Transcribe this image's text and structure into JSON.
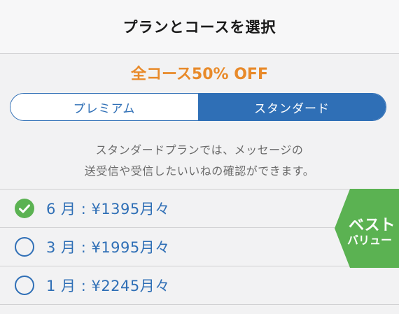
{
  "header": {
    "title": "プランとコースを選択"
  },
  "promo": {
    "text": "全コース50% OFF"
  },
  "toggle": {
    "premium_label": "プレミアム",
    "standard_label": "スタンダード",
    "selected": "standard"
  },
  "description": {
    "line1": "スタンダードプランでは、メッセージの",
    "line2": "送受信や受信したいいねの確認ができます。"
  },
  "plans": [
    {
      "label": "6 月 : ¥1395月々",
      "selected": true
    },
    {
      "label": "3 月 : ¥1995月々",
      "selected": false
    },
    {
      "label": "1 月 : ¥2245月々",
      "selected": false
    }
  ],
  "badge": {
    "line1": "ベスト",
    "line2": "バリュー"
  },
  "colors": {
    "accent": "#2f6fb6",
    "promo": "#e88a2a",
    "badge": "#5bb252"
  }
}
